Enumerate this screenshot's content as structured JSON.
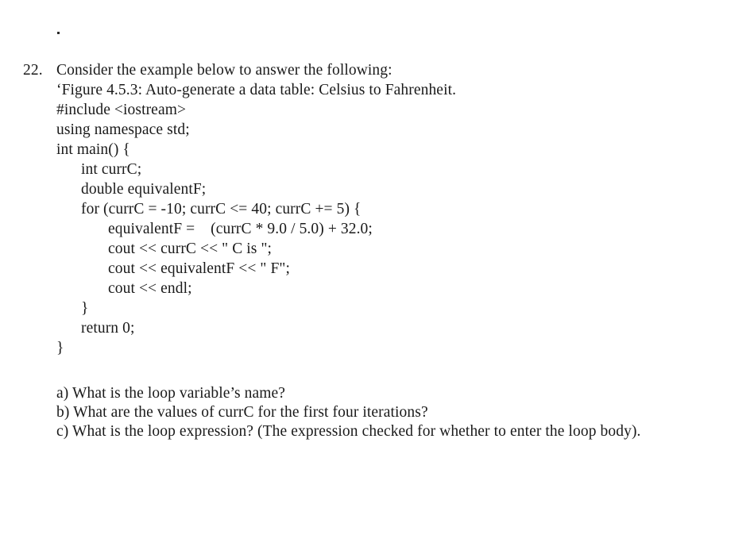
{
  "page": {
    "background_color": "#ffffff",
    "text_color": "#1a1a1a",
    "artifact_mark": "."
  },
  "exercise": {
    "number": "22.",
    "prompt": "Consider the example below to answer the following:",
    "figure_caption": "‘Figure 4.5.3: Auto-generate a data table: Celsius to Fahrenheit."
  },
  "code": {
    "lines": [
      {
        "indent": 0,
        "text": "#include <iostream>"
      },
      {
        "indent": 0,
        "text": "using namespace std;"
      },
      {
        "indent": 0,
        "text": "int main() {"
      },
      {
        "indent": 1,
        "text": "int currC;"
      },
      {
        "indent": 1,
        "text": "double equivalentF;"
      },
      {
        "indent": 1,
        "text": "for (currC = -10; currC <= 40; currC += 5) {"
      },
      {
        "indent": 2,
        "text": "equivalentF =    (currC * 9.0 / 5.0) + 32.0;"
      },
      {
        "indent": 2,
        "text": "cout << currC << \" C is \";"
      },
      {
        "indent": 2,
        "text": "cout << equivalentF << \" F\";"
      },
      {
        "indent": 2,
        "text": "cout << endl;"
      },
      {
        "indent": 1,
        "text": "}"
      },
      {
        "indent": 1,
        "text": "return 0;"
      },
      {
        "indent": 0,
        "text": "}"
      }
    ]
  },
  "questions": [
    {
      "label": "a)",
      "text": "a) What is the loop variable’s name?"
    },
    {
      "label": "b)",
      "text": "b) What are the values of currC for the first four iterations?"
    },
    {
      "label": "c)",
      "text": "c) What is the loop expression? (The expression checked for whether to enter the loop body)."
    }
  ]
}
